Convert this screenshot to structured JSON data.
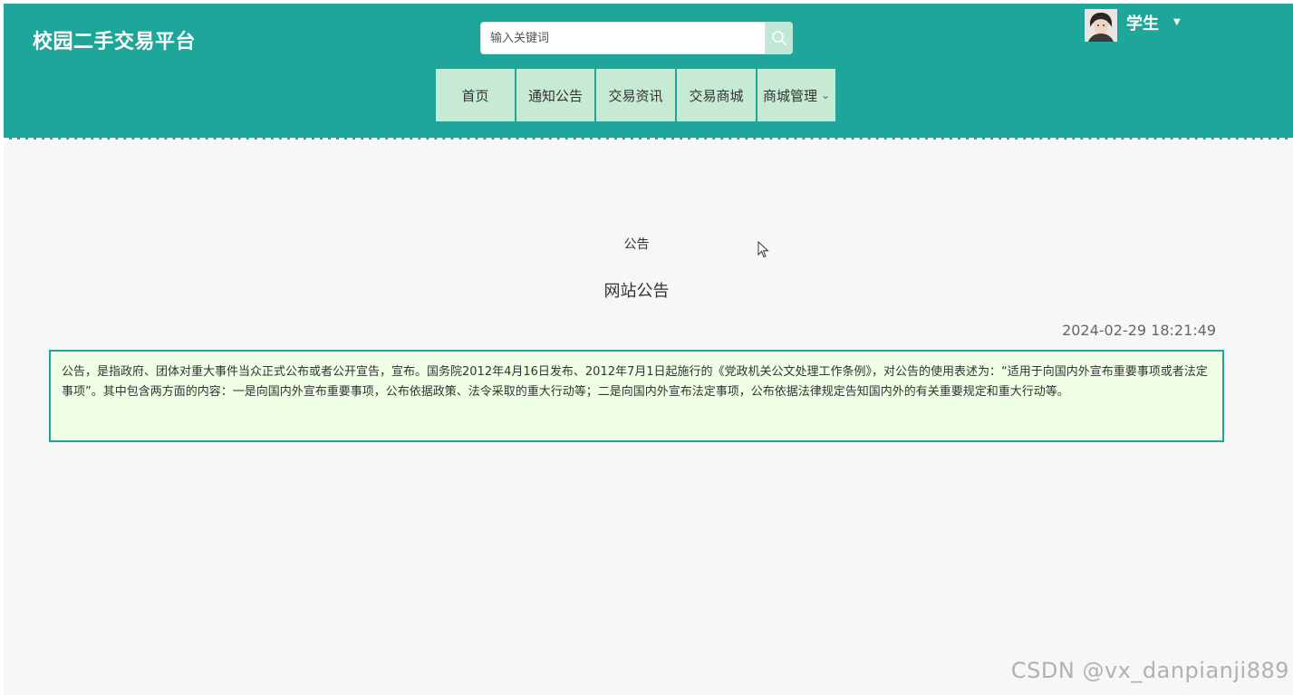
{
  "header": {
    "logo": "校园二手交易平台",
    "search": {
      "placeholder": "输入关键词",
      "icon": "search-icon"
    },
    "user": {
      "name": "学生",
      "avatar_icon": "user-avatar",
      "caret_icon": "caret-down-icon"
    }
  },
  "nav": {
    "items": [
      {
        "label": "首页"
      },
      {
        "label": "通知公告"
      },
      {
        "label": "交易资讯"
      },
      {
        "label": "交易商城"
      },
      {
        "label": "商城管理",
        "icon": "chevron-down-icon"
      }
    ]
  },
  "notice": {
    "category": "公告",
    "title": "网站公告",
    "datetime": "2024-02-29 18:21:49",
    "body": "公告，是指政府、团体对重大事件当众正式公布或者公开宣告，宣布。国务院2012年4月16日发布、2012年7月1日起施行的《党政机关公文处理工作条例》，对公告的使用表述为：“适用于向国内外宣布重要事项或者法定事项”。其中包含两方面的内容：一是向国内外宣布重要事项，公布依据政策、法令采取的重大行动等；二是向国内外宣布法定事项，公布依据法律规定告知国内外的有关重要规定和重大行动等。"
  },
  "watermark": "CSDN @vx_danpianji889",
  "colors": {
    "header_bg": "#1fa69a",
    "nav_bg": "#c6ead3",
    "content_bg": "#eeffe5",
    "content_border": "#1fa69a"
  }
}
